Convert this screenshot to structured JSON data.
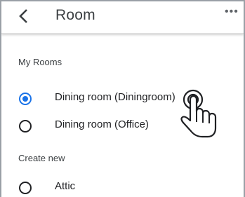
{
  "header": {
    "title": "Room",
    "back_icon": "chevron-left-icon",
    "more_icon": "more-horiz-icon",
    "more_label": "•••"
  },
  "sections": {
    "my_rooms": {
      "label": "My Rooms",
      "items": [
        {
          "label": "Dining room (Diningroom)",
          "selected": true
        },
        {
          "label": "Dining room (Office)",
          "selected": false
        }
      ]
    },
    "create_new": {
      "label": "Create new",
      "items": [
        {
          "label": "Attic",
          "selected": false
        }
      ]
    }
  },
  "overlay": {
    "icon": "tap-gesture-icon"
  },
  "colors": {
    "accent": "#1a73e8",
    "text_primary": "#202124",
    "text_secondary": "#3c4043"
  }
}
